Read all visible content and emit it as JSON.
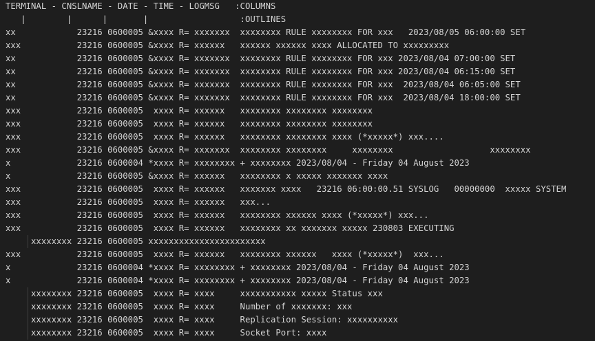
{
  "terminal": {
    "header": "TERMINAL - CNSLNAME - DATE - TIME - LOGMSG   :COLUMNS",
    "outline_header": "   |        |      |       |                  :OUTLINES",
    "lines": [
      "xx            23216 0600005 &xxxx R= xxxxxxx  xxxxxxxx RULE xxxxxxxx FOR xxx   2023/08/05 06:00:00 SET",
      "xxx           23216 0600005 &xxxx R= xxxxxx   xxxxxx xxxxxx xxxx ALLOCATED TO xxxxxxxxx",
      "xx            23216 0600005 &xxxx R= xxxxxxx  xxxxxxxx RULE xxxxxxxx FOR xxx 2023/08/04 07:00:00 SET",
      "xx            23216 0600005 &xxxx R= xxxxxxx  xxxxxxxx RULE xxxxxxxx FOR xxx 2023/08/04 06:15:00 SET",
      "xx            23216 0600005 &xxxx R= xxxxxxx  xxxxxxxx RULE xxxxxxxx FOR xxx  2023/08/04 06:05:00 SET",
      "xx            23216 0600005 &xxxx R= xxxxxxx  xxxxxxxx RULE xxxxxxxx FOR xxx  2023/08/04 18:00:00 SET",
      "xxx           23216 0600005  xxxx R= xxxxxx   xxxxxxxx xxxxxxxx xxxxxxxx",
      "xxx           23216 0600005  xxxx R= xxxxxx   xxxxxxxx xxxxxxxx xxxxxxxx",
      "xxx           23216 0600005  xxxx R= xxxxxx   xxxxxxxx xxxxxxxx xxxx (*xxxxx*) xxx....",
      "xxx           23216 0600005 &xxxx R= xxxxxxx  xxxxxxxx xxxxxxxx     xxxxxxxx                   xxxxxxxx",
      "x             23216 0600004 *xxxx R= xxxxxxxx + xxxxxxxx 2023/08/04 - Friday 04 August 2023",
      "x             23216 0600005 &xxxx R= xxxxxx   xxxxxxxx x xxxxx xxxxxxx xxxx",
      "xxx           23216 0600005  xxxx R= xxxxxx   xxxxxxx xxxx   23216 06:00:00.51 SYSLOG   00000000  xxxxx SYSTEM",
      "xxx           23216 0600005  xxxx R= xxxxxx   xxx...",
      "xxx           23216 0600005  xxxx R= xxxxxx   xxxxxxxx xxxxxx xxxx (*xxxxx*) xxx...",
      "xxx           23216 0600005  xxxx R= xxxxxx   xxxxxxxx xx xxxxxxx xxxxx 230803 EXECUTING",
      "     xxxxxxxx 23216 0600005 xxxxxxxxxxxxxxxxxxxxxxx",
      "xxx           23216 0600005  xxxx R= xxxxxx   xxxxxxxx xxxxxx   xxxx (*xxxxx*)  xxx...",
      "x             23216 0600004 *xxxx R= xxxxxxxx + xxxxxxxx 2023/08/04 - Friday 04 August 2023",
      "x             23216 0600004 *xxxx R= xxxxxxxx + xxxxxxxx 2023/08/04 - Friday 04 August 2023",
      "     xxxxxxxx 23216 0600005  xxxx R= xxxx     xxxxxxxxxxx xxxxx Status xxx",
      "     xxxxxxxx 23216 0600005  xxxx R= xxxx     Number of xxxxxxx: xxx",
      "     xxxxxxxx 23216 0600005  xxxx R= xxxx     Replication Session: xxxxxxxxxx",
      "     xxxxxxxx 23216 0600005  xxxx R= xxxx     Socket Port: xxxx"
    ]
  }
}
